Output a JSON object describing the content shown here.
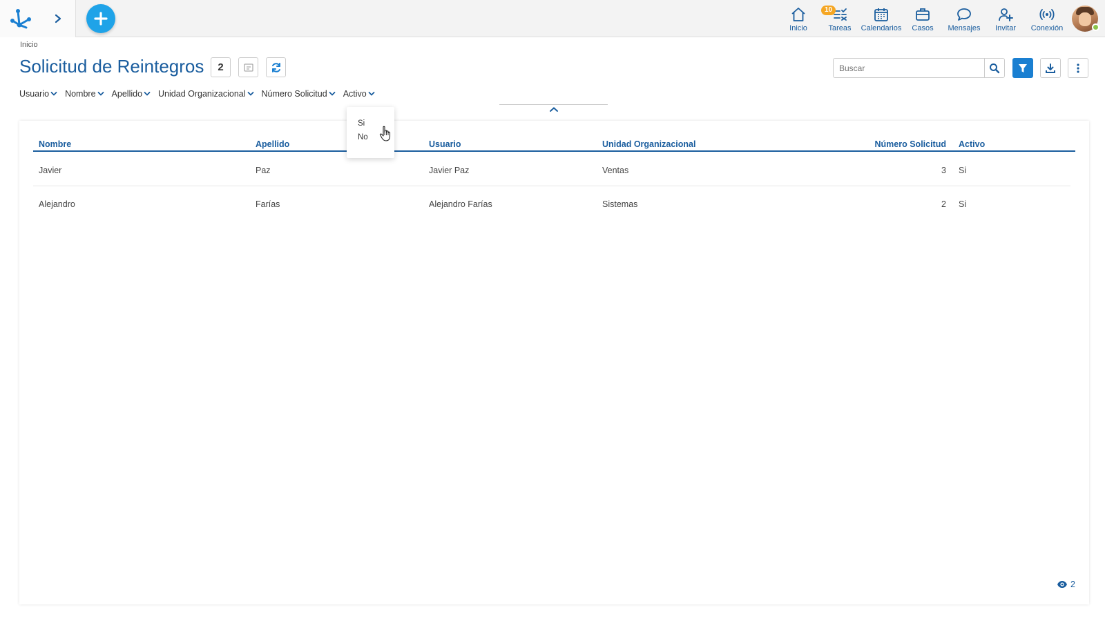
{
  "topbar": {
    "nav": [
      {
        "label": "Inicio",
        "icon": "home-icon"
      },
      {
        "label": "Tareas",
        "icon": "tasks-icon",
        "badge": "10"
      },
      {
        "label": "Calendarios",
        "icon": "calendar-icon"
      },
      {
        "label": "Casos",
        "icon": "briefcase-icon"
      },
      {
        "label": "Mensajes",
        "icon": "chat-icon"
      },
      {
        "label": "Invitar",
        "icon": "invite-user-icon"
      },
      {
        "label": "Conexión",
        "icon": "connection-icon"
      }
    ]
  },
  "breadcrumb": "Inicio",
  "page": {
    "title": "Solicitud de Reintegros",
    "count": "2"
  },
  "search": {
    "placeholder": "Buscar"
  },
  "filters": [
    {
      "label": "Usuario"
    },
    {
      "label": "Nombre"
    },
    {
      "label": "Apellido"
    },
    {
      "label": "Unidad Organizacional"
    },
    {
      "label": "Número Solicitud"
    },
    {
      "label": "Activo"
    }
  ],
  "dropdown": {
    "options": [
      "Si",
      "No"
    ]
  },
  "table": {
    "columns": [
      "Nombre",
      "Apellido",
      "Usuario",
      "Unidad Organizacional",
      "Número Solicitud",
      "Activo"
    ],
    "rows": [
      [
        "Javier",
        "Paz",
        "Javier Paz",
        "Ventas",
        "3",
        "Si"
      ],
      [
        "Alejandro",
        "Farías",
        "Alejandro Farías",
        "Sistemas",
        "2",
        "Si"
      ]
    ]
  },
  "footer": {
    "view_count": "2"
  },
  "colors": {
    "primary": "#1a5d9e",
    "accent": "#1fa3e8",
    "badge": "#f5a623",
    "online": "#8bc34a"
  }
}
